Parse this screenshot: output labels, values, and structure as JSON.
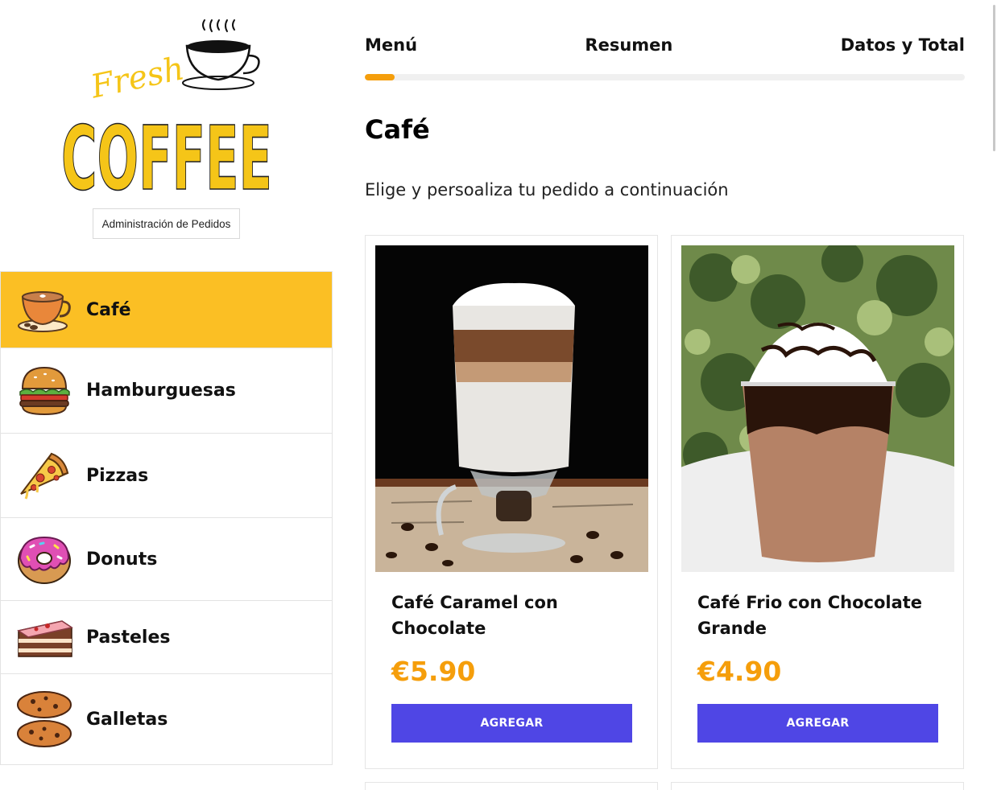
{
  "brand": {
    "logo_script": "Fresh",
    "logo_main": "COFFEE",
    "accent": "#fbbf24"
  },
  "admin_button": "Administración de Pedidos",
  "categories": [
    {
      "label": "Café",
      "icon": "coffee-cup-icon",
      "active": true
    },
    {
      "label": "Hamburguesas",
      "icon": "burger-icon",
      "active": false
    },
    {
      "label": "Pizzas",
      "icon": "pizza-icon",
      "active": false
    },
    {
      "label": "Donuts",
      "icon": "donut-icon",
      "active": false
    },
    {
      "label": "Pasteles",
      "icon": "cake-icon",
      "active": false
    },
    {
      "label": "Galletas",
      "icon": "cookies-icon",
      "active": false
    }
  ],
  "steps": {
    "items": [
      "Menú",
      "Resumen",
      "Datos y Total"
    ],
    "progress": 0.05,
    "progress_color": "#f59e0b"
  },
  "main": {
    "title": "Café",
    "subtitle": "Elige y persoaliza tu pedido a continuación"
  },
  "products": [
    {
      "name": "Café Caramel con Chocolate",
      "price": "€5.90",
      "button": "AGREGAR",
      "image": "latte-macchiato-photo"
    },
    {
      "name": "Café Frio con Chocolate Grande",
      "price": "€4.90",
      "button": "AGREGAR",
      "image": "iced-mocha-photo"
    }
  ],
  "colors": {
    "price": "#f59e0b",
    "button": "#4f46e5"
  }
}
